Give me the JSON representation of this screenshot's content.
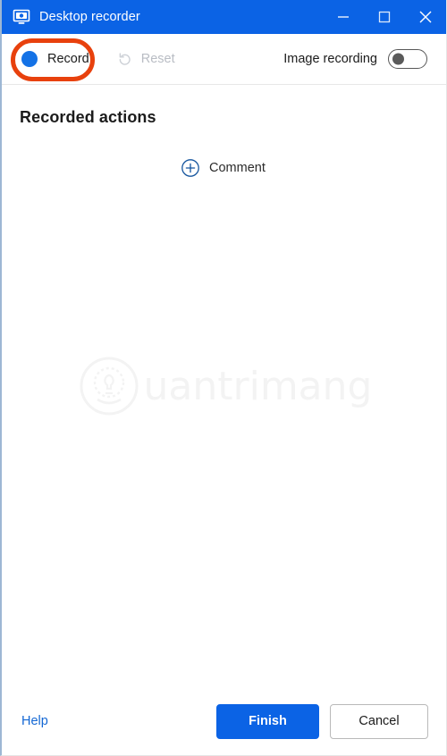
{
  "window": {
    "title": "Desktop recorder",
    "app_icon": "monitor-icon",
    "controls": {
      "minimize": "minimize-icon",
      "maximize": "maximize-icon",
      "close": "close-icon"
    }
  },
  "toolbar": {
    "record_label": "Record",
    "record_icon": "record-dot-icon",
    "reset_label": "Reset",
    "reset_icon": "undo-arrow-icon",
    "reset_disabled": true,
    "image_recording_label": "Image recording",
    "image_recording_on": false
  },
  "annotation": {
    "shape": "ellipse-highlight",
    "target": "record-button",
    "color": "#e8410d"
  },
  "main": {
    "section_title": "Recorded actions",
    "comment_label": "Comment",
    "comment_icon": "plus-circle-icon",
    "watermark_text": "uantrimang",
    "watermark_logo": "quantrimang-logo-icon"
  },
  "footer": {
    "help_label": "Help",
    "finish_label": "Finish",
    "cancel_label": "Cancel"
  },
  "colors": {
    "titlebar_blue": "#0b63e5",
    "primary_blue": "#0b63e5",
    "record_dot_blue": "#1472e6",
    "annotation_red": "#e8410d",
    "link_blue": "#1367d4",
    "disabled_gray": "#b9bdc4"
  }
}
